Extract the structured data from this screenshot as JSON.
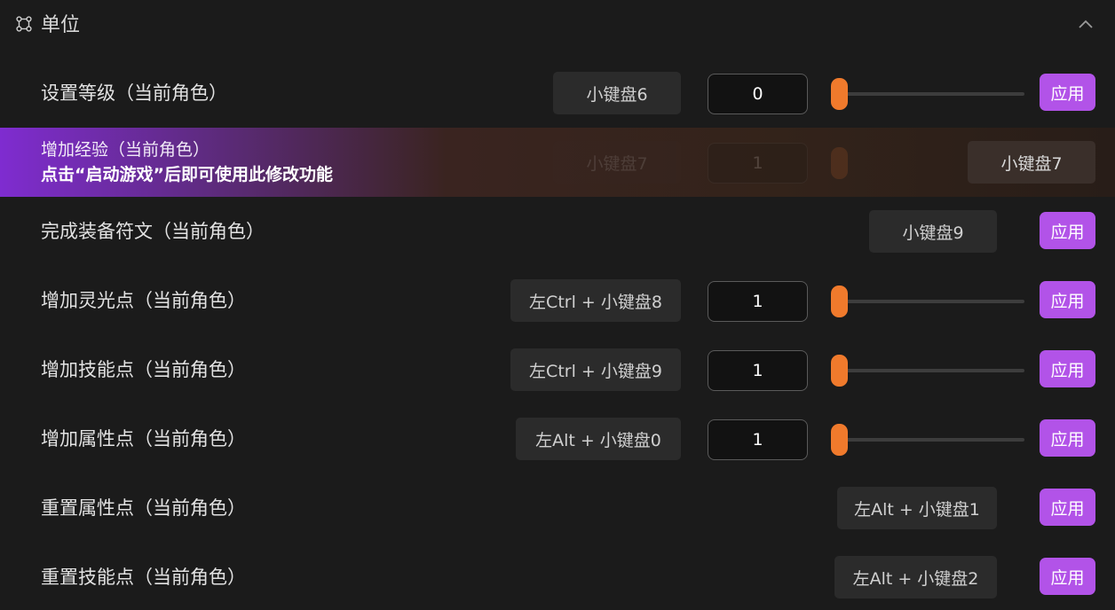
{
  "section": {
    "title": "单位",
    "icon": "group-nodes-icon",
    "collapse_icon": "chevron-up-icon"
  },
  "rows": [
    {
      "label": "设置等级（当前角色）",
      "hotkey": "小键盘6",
      "input_value": "0",
      "slider_value": 0,
      "apply": "应用"
    },
    {
      "label": "增加经验（当前角色）",
      "notice": "点击“启动游戏”后即可使用此修改功能",
      "hotkey": "小键盘7",
      "ghost_hotkey": "小键盘7",
      "ghost_input": "1"
    },
    {
      "label": "完成装备符文（当前角色）",
      "hotkey": "小键盘9",
      "apply": "应用"
    },
    {
      "label": "增加灵光点（当前角色）",
      "hotkey": "左Ctrl + 小键盘8",
      "input_value": "1",
      "slider_value": 0,
      "apply": "应用"
    },
    {
      "label": "增加技能点（当前角色）",
      "hotkey": "左Ctrl + 小键盘9",
      "input_value": "1",
      "slider_value": 0,
      "apply": "应用"
    },
    {
      "label": "增加属性点（当前角色）",
      "hotkey": "左Alt + 小键盘0",
      "input_value": "1",
      "slider_value": 0,
      "apply": "应用"
    },
    {
      "label": "重置属性点（当前角色）",
      "hotkey": "左Alt + 小键盘1",
      "apply": "应用"
    },
    {
      "label": "重置技能点（当前角色）",
      "hotkey": "左Alt + 小键盘2",
      "apply": "应用"
    }
  ],
  "colors": {
    "accent": "#b253e8",
    "slider_thumb": "#f07a2c",
    "background": "#1b1b1b"
  }
}
